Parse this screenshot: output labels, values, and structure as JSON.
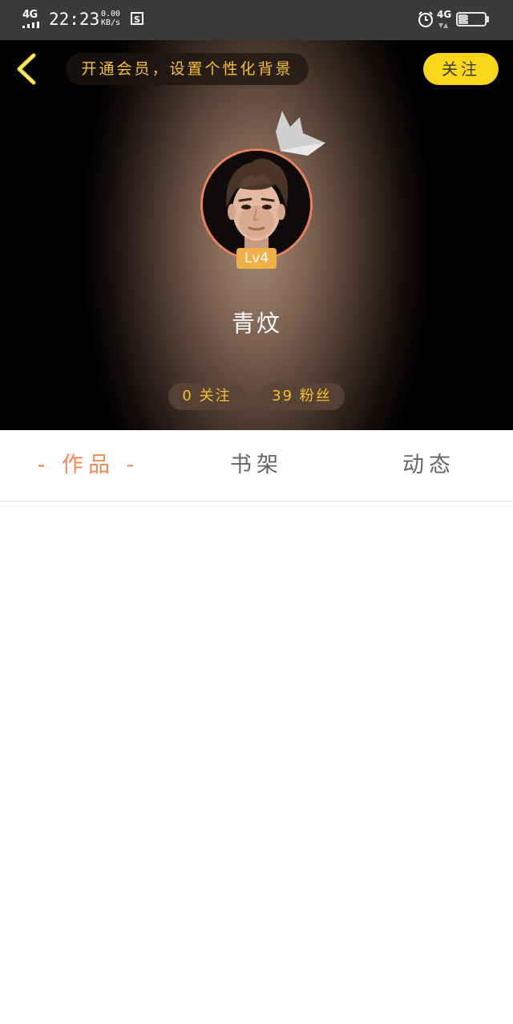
{
  "status_bar": {
    "network_left": "4G",
    "time": "22:23",
    "speed_value": "0.00",
    "speed_unit": "KB/s",
    "network_right": "4G",
    "battery": "37",
    "battery_level": 0.37
  },
  "header": {
    "vip_banner": "开通会员，设置个性化背景",
    "follow_label": "关注",
    "level_badge": "Lv4",
    "username": "青炆",
    "stats": {
      "following": "0 关注",
      "fans": "39 粉丝"
    }
  },
  "tabs": [
    {
      "label": "- 作品 -",
      "active": true
    },
    {
      "label": "书架",
      "active": false
    },
    {
      "label": "动态",
      "active": false
    }
  ],
  "colors": {
    "accent_yellow": "#f8d61a",
    "banner_text": "#f5c12e",
    "active_tab": "#ef8a55",
    "avatar_ring": "#e9825a",
    "level_badge": "#f0b048"
  },
  "icons": [
    "signal-icon",
    "screenshot-icon",
    "alarm-icon",
    "battery-icon",
    "back-arrow-icon",
    "crown-icon"
  ]
}
